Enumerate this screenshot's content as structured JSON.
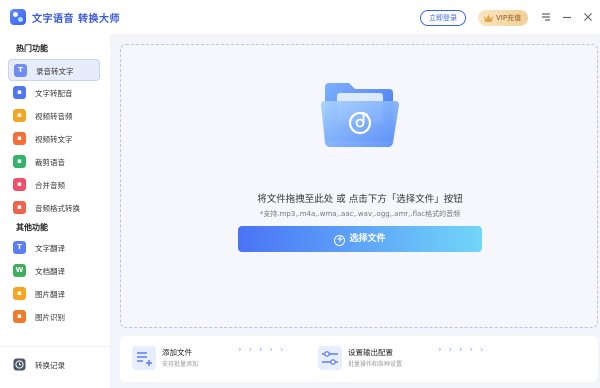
{
  "app": {
    "title": "文字语音 转换大师"
  },
  "header": {
    "login_label": "立即登录",
    "vip_label": "VIP充值"
  },
  "sidebar": {
    "hot_title": "热门功能",
    "other_title": "其他功能",
    "hot_items": [
      {
        "label": "录音转文字",
        "icon": "audio-to-text-icon",
        "glyph": "T",
        "color": "#6f8cf5"
      },
      {
        "label": "文字转配音",
        "icon": "microphone-icon",
        "glyph": "",
        "color": "#4f77f2"
      },
      {
        "label": "视频转音频",
        "icon": "video-to-audio-icon",
        "glyph": "",
        "color": "#f5a623"
      },
      {
        "label": "视频转文字",
        "icon": "video-to-text-icon",
        "glyph": "",
        "color": "#f46f3a"
      },
      {
        "label": "裁剪语音",
        "icon": "crop-audio-icon",
        "glyph": "",
        "color": "#35b36b"
      },
      {
        "label": "合并音频",
        "icon": "merge-audio-icon",
        "glyph": "",
        "color": "#ef4f6b"
      },
      {
        "label": "音频格式转换",
        "icon": "audio-format-icon",
        "glyph": "",
        "color": "#f0624d"
      }
    ],
    "other_items": [
      {
        "label": "文字翻译",
        "icon": "text-translate-icon",
        "glyph": "T",
        "color": "#5b7ff3"
      },
      {
        "label": "文档翻译",
        "icon": "doc-translate-icon",
        "glyph": "W",
        "color": "#3fae5c"
      },
      {
        "label": "图片翻译",
        "icon": "image-translate-icon",
        "glyph": "",
        "color": "#f5a623"
      },
      {
        "label": "图片识别",
        "icon": "image-recognize-icon",
        "glyph": "",
        "color": "#f07a2d"
      }
    ],
    "history_label": "转换记录"
  },
  "main": {
    "hint": "将文件拖拽至此处 或 点击下方「选择文件」按钮",
    "subhint": "*支持.mp3,.m4a,.wma,.aac,.wav,.ogg,.amr,.flac格式的音频",
    "select_button_label": "选择文件"
  },
  "bottom": {
    "add_title": "添加文件",
    "add_sub": "支持批量添加",
    "config_title": "设置输出配置",
    "config_sub": "批量操作和各种设置",
    "arrows": "› › › › ›"
  },
  "colors": {
    "accent": "#3b63f3",
    "gradient_end": "#72d6f8"
  }
}
